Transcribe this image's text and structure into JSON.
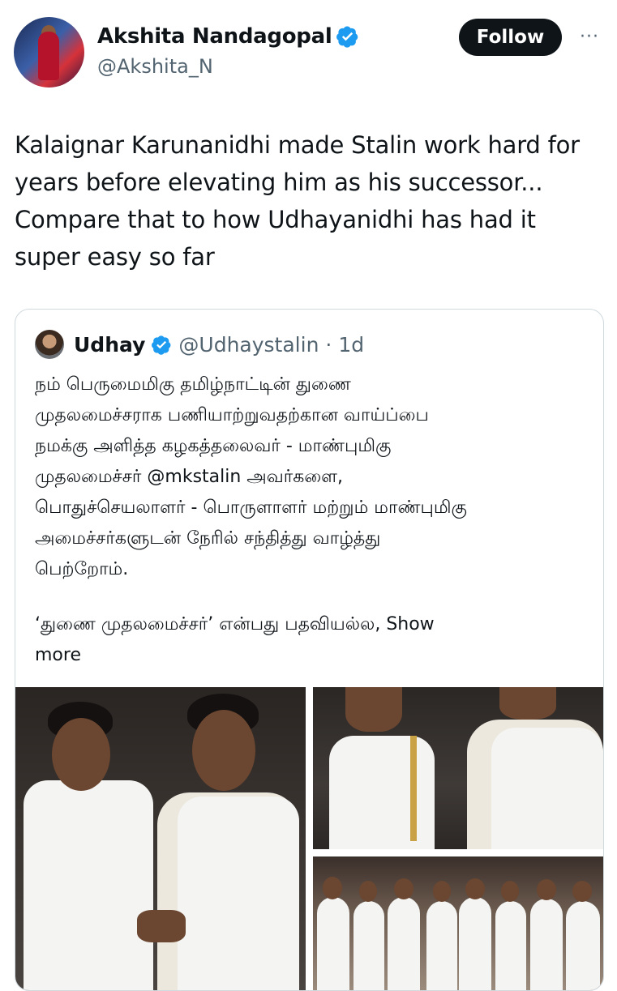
{
  "tweet": {
    "author_name": "Akshita Nandagopal",
    "author_handle": "@Akshita_N",
    "follow_label": "Follow",
    "more_label": "···",
    "text_lines": [
      "Kalaignar Karunanidhi made Stalin work hard for",
      "years before elevating him as his successor...",
      "Compare that to how Udhayanidhi has had it",
      "super easy so far"
    ]
  },
  "quote": {
    "author_name": "Udhay",
    "author_handle": "@Udhaystalin",
    "separator": "·",
    "time": "1d",
    "text_lines": [
      "நம் பெருமைமிகு தமிழ்நாட்டின் துணை",
      "முதலமைச்சராக பணியாற்றுவதற்கான வாய்ப்பை",
      "நமக்கு அளித்த கழகத்தலைவர் - மாண்புமிகு",
      "முதலமைச்சர் @mkstalin அவர்களை,",
      "பொதுச்செயலாளர் - பொருளாளர் மற்றும் மாண்புமிகு",
      "அமைச்சர்களுடன் நேரில் சந்தித்து வாழ்த்து",
      "பெற்றோம்."
    ],
    "second_para_line": "‘துணை முதலமைச்சர்’ என்பது பதவியல்ல, ",
    "show_more_1": "Show",
    "show_more_2": "more"
  },
  "colors": {
    "text": "#0f1419",
    "secondary": "#536471",
    "verified_blue": "#1d9bf0",
    "border": "#cfd9de",
    "follow_bg": "#0f1419"
  }
}
